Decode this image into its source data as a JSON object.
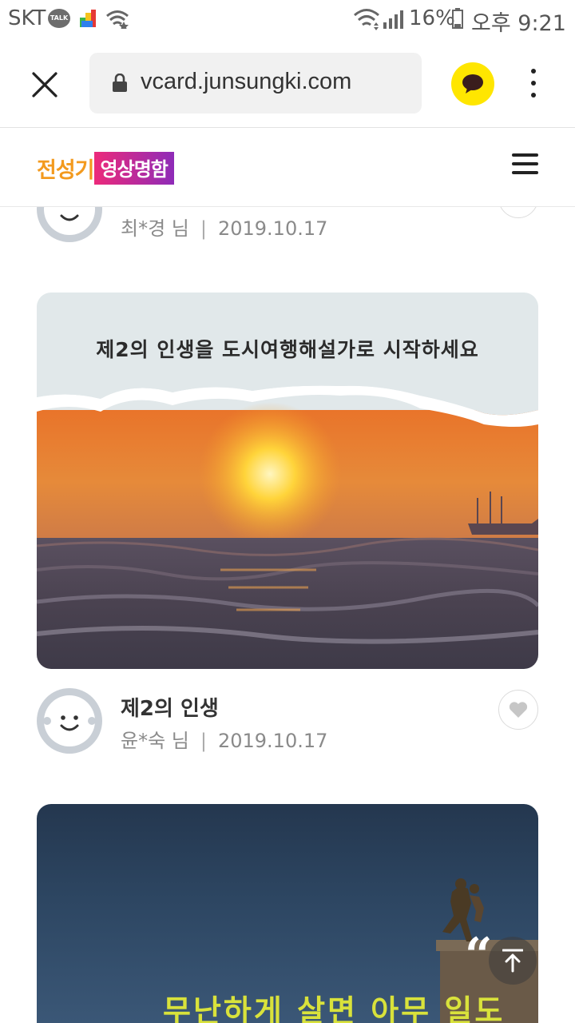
{
  "status_bar": {
    "carrier": "SKT",
    "talk_badge": "TALK",
    "battery_percent": "16%",
    "time": "오후 9:21"
  },
  "browser": {
    "url": "vcard.junsungki.com"
  },
  "site_header": {
    "logo_part1": "전성기",
    "logo_part2": "영상명함"
  },
  "posts": [
    {
      "author": "최*경 님",
      "date": "2019.10.17"
    },
    {
      "image_caption": "제2의 인생을 도시여행해설가로 시작하세요",
      "title": "제2의 인생",
      "author": "윤*숙 님",
      "date": "2019.10.17"
    },
    {
      "image_caption": "무난하게 살면 아무 일도"
    }
  ],
  "colors": {
    "kakao_yellow": "#FFE600",
    "logo_orange": "#f39a1e",
    "logo_pink": "#ec2a7a",
    "logo_purple": "#8e2bb8",
    "caption_yellow": "#d9e23b"
  }
}
